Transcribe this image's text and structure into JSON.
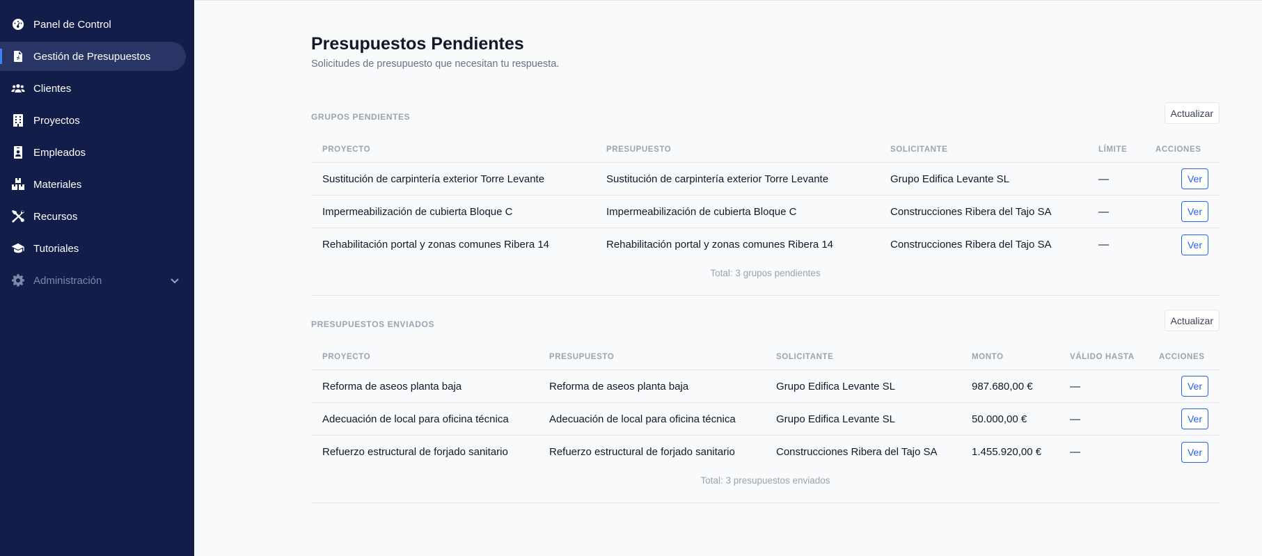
{
  "sidebar": {
    "items": [
      {
        "label": "Panel de Control",
        "icon": "gauge-icon"
      },
      {
        "label": "Gestión de Presupuestos",
        "icon": "file-invoice-icon"
      },
      {
        "label": "Clientes",
        "icon": "users-icon"
      },
      {
        "label": "Proyectos",
        "icon": "building-icon"
      },
      {
        "label": "Empleados",
        "icon": "id-badge-icon"
      },
      {
        "label": "Materiales",
        "icon": "boxes-icon"
      },
      {
        "label": "Recursos",
        "icon": "tools-icon"
      },
      {
        "label": "Tutoriales",
        "icon": "graduation-cap-icon"
      },
      {
        "label": "Administración",
        "icon": "gear-icon"
      }
    ]
  },
  "page": {
    "title": "Presupuestos Pendientes",
    "subtitle": "Solicitudes de presupuesto que necesitan tu respuesta."
  },
  "pending": {
    "title": "GRUPOS PENDIENTES",
    "refresh_label": "Actualizar",
    "columns": [
      "PROYECTO",
      "PRESUPUESTO",
      "SOLICITANTE",
      "LÍMITE",
      "ACCIONES"
    ],
    "rows": [
      {
        "proyecto": "Sustitución de carpintería exterior Torre Levante",
        "presupuesto": "Sustitución de carpintería exterior Torre Levante",
        "solicitante": "Grupo Edifica Levante SL",
        "limite": "—",
        "action": "Ver"
      },
      {
        "proyecto": "Impermeabilización de cubierta Bloque C",
        "presupuesto": "Impermeabilización de cubierta Bloque C",
        "solicitante": "Construcciones Ribera del Tajo SA",
        "limite": "—",
        "action": "Ver"
      },
      {
        "proyecto": "Rehabilitación portal y zonas comunes Ribera 14",
        "presupuesto": "Rehabilitación portal y zonas comunes Ribera 14",
        "solicitante": "Construcciones Ribera del Tajo SA",
        "limite": "—",
        "action": "Ver"
      }
    ],
    "total": "Total: 3 grupos pendientes"
  },
  "sent": {
    "title": "PRESUPUESTOS ENVIADOS",
    "refresh_label": "Actualizar",
    "columns": [
      "PROYECTO",
      "PRESUPUESTO",
      "SOLICITANTE",
      "MONTO",
      "VÁLIDO HASTA",
      "ACCIONES"
    ],
    "rows": [
      {
        "proyecto": "Reforma de aseos planta baja",
        "presupuesto": "Reforma de aseos planta baja",
        "solicitante": "Grupo Edifica Levante SL",
        "monto": "987.680,00 €",
        "valido": "—",
        "action": "Ver"
      },
      {
        "proyecto": "Adecuación de local para oficina técnica",
        "presupuesto": "Adecuación de local para oficina técnica",
        "solicitante": "Grupo Edifica Levante SL",
        "monto": "50.000,00 €",
        "valido": "—",
        "action": "Ver"
      },
      {
        "proyecto": "Refuerzo estructural de forjado sanitario",
        "presupuesto": "Refuerzo estructural de forjado sanitario",
        "solicitante": "Construcciones Ribera del Tajo SA",
        "monto": "1.455.920,00 €",
        "valido": "—",
        "action": "Ver"
      }
    ],
    "total": "Total: 3 presupuestos enviados"
  },
  "colors": {
    "sidebar_bg": "#131d4a",
    "active_item_bg": "#293565",
    "accent": "#2563eb"
  }
}
